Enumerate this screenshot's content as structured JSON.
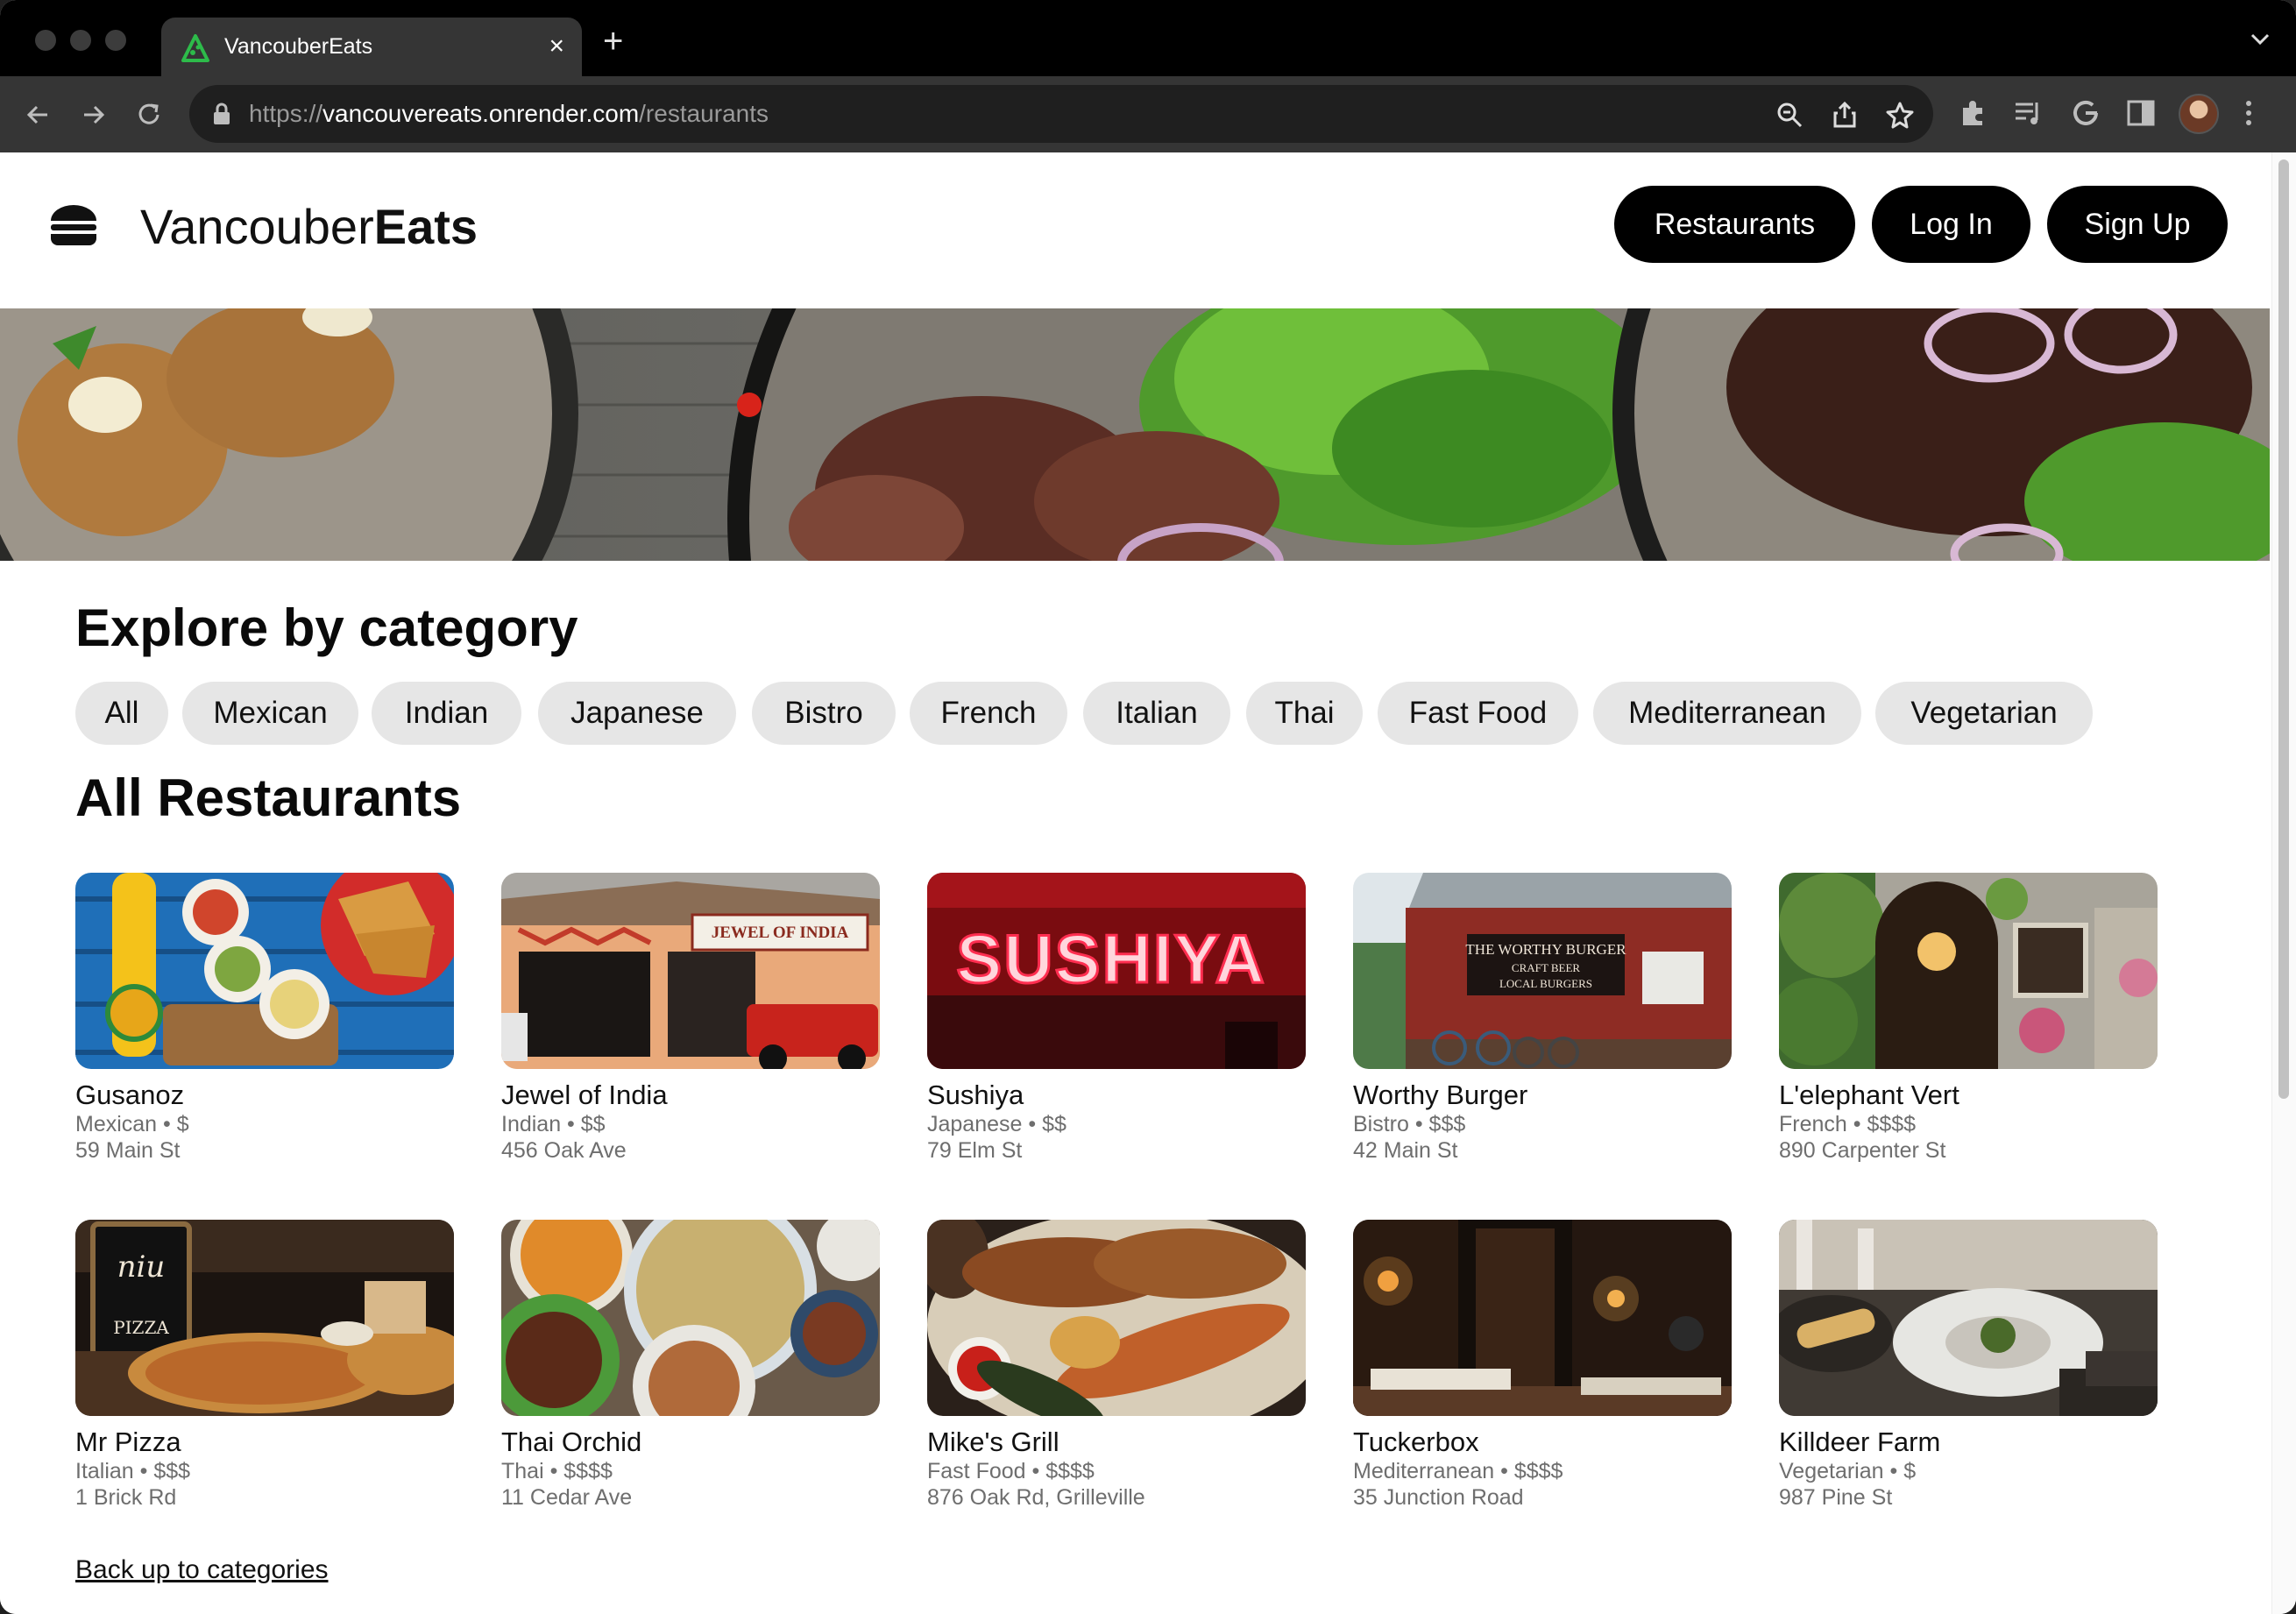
{
  "browser": {
    "tab_title": "VancouberEats",
    "tab_close": "×",
    "new_tab": "+",
    "url_scheme": "https://",
    "url_host": "vancouvereats.onrender.com",
    "url_path": "/restaurants"
  },
  "header": {
    "brand_light": "Vancouber",
    "brand_bold": "Eats",
    "nav": [
      {
        "label": "Restaurants"
      },
      {
        "label": "Log In"
      },
      {
        "label": "Sign Up"
      }
    ]
  },
  "explore": {
    "heading": "Explore by category",
    "categories": [
      "All",
      "Mexican",
      "Indian",
      "Japanese",
      "Bistro",
      "French",
      "Italian",
      "Thai",
      "Fast Food",
      "Mediterranean",
      "Vegetarian"
    ]
  },
  "restaurants": {
    "heading": "All Restaurants",
    "items": [
      {
        "name": "Gusanoz",
        "meta": "Mexican • $",
        "address": "59 Main St"
      },
      {
        "name": "Jewel of India",
        "meta": "Indian • $$",
        "address": "456 Oak Ave"
      },
      {
        "name": "Sushiya",
        "meta": "Japanese • $$",
        "address": "79 Elm St"
      },
      {
        "name": "Worthy Burger",
        "meta": "Bistro • $$$",
        "address": "42 Main St"
      },
      {
        "name": "L'elephant Vert",
        "meta": "French • $$$$",
        "address": "890 Carpenter St"
      },
      {
        "name": "Mr Pizza",
        "meta": "Italian • $$$",
        "address": "1 Brick Rd"
      },
      {
        "name": "Thai Orchid",
        "meta": "Thai • $$$$",
        "address": "11 Cedar Ave"
      },
      {
        "name": "Mike's Grill",
        "meta": "Fast Food • $$$$",
        "address": "876 Oak Rd, Grilleville"
      },
      {
        "name": "Tuckerbox",
        "meta": "Mediterranean • $$$$",
        "address": "35 Junction Road"
      },
      {
        "name": "Killdeer Farm",
        "meta": "Vegetarian • $",
        "address": "987 Pine St"
      }
    ],
    "image_signs": {
      "jewel": "JEWEL OF INDIA",
      "sushiya": "SUSHIYA",
      "burger_1": "THE WORTHY BURGER",
      "burger_2": "CRAFT BEER",
      "burger_3": "LOCAL BURGERS",
      "pizza_1": "niu",
      "pizza_2": "PIZZA"
    }
  },
  "footer": {
    "back_link": "Back up to categories"
  },
  "colors": {
    "pill_bg": "#000000",
    "chip_bg": "#e6e6e6",
    "chrome_dark": "#353535"
  }
}
